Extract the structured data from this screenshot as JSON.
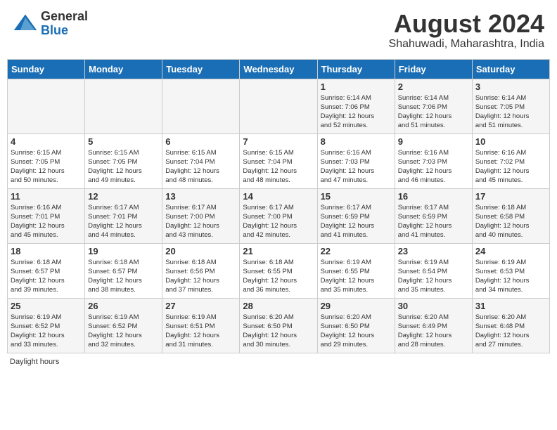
{
  "header": {
    "logo_general": "General",
    "logo_blue": "Blue",
    "month_year": "August 2024",
    "location": "Shahuwadi, Maharashtra, India"
  },
  "days_of_week": [
    "Sunday",
    "Monday",
    "Tuesday",
    "Wednesday",
    "Thursday",
    "Friday",
    "Saturday"
  ],
  "footer": {
    "daylight_label": "Daylight hours"
  },
  "weeks": [
    [
      {
        "num": "",
        "info": ""
      },
      {
        "num": "",
        "info": ""
      },
      {
        "num": "",
        "info": ""
      },
      {
        "num": "",
        "info": ""
      },
      {
        "num": "1",
        "info": "Sunrise: 6:14 AM\nSunset: 7:06 PM\nDaylight: 12 hours\nand 52 minutes."
      },
      {
        "num": "2",
        "info": "Sunrise: 6:14 AM\nSunset: 7:06 PM\nDaylight: 12 hours\nand 51 minutes."
      },
      {
        "num": "3",
        "info": "Sunrise: 6:14 AM\nSunset: 7:05 PM\nDaylight: 12 hours\nand 51 minutes."
      }
    ],
    [
      {
        "num": "4",
        "info": "Sunrise: 6:15 AM\nSunset: 7:05 PM\nDaylight: 12 hours\nand 50 minutes."
      },
      {
        "num": "5",
        "info": "Sunrise: 6:15 AM\nSunset: 7:05 PM\nDaylight: 12 hours\nand 49 minutes."
      },
      {
        "num": "6",
        "info": "Sunrise: 6:15 AM\nSunset: 7:04 PM\nDaylight: 12 hours\nand 48 minutes."
      },
      {
        "num": "7",
        "info": "Sunrise: 6:15 AM\nSunset: 7:04 PM\nDaylight: 12 hours\nand 48 minutes."
      },
      {
        "num": "8",
        "info": "Sunrise: 6:16 AM\nSunset: 7:03 PM\nDaylight: 12 hours\nand 47 minutes."
      },
      {
        "num": "9",
        "info": "Sunrise: 6:16 AM\nSunset: 7:03 PM\nDaylight: 12 hours\nand 46 minutes."
      },
      {
        "num": "10",
        "info": "Sunrise: 6:16 AM\nSunset: 7:02 PM\nDaylight: 12 hours\nand 45 minutes."
      }
    ],
    [
      {
        "num": "11",
        "info": "Sunrise: 6:16 AM\nSunset: 7:01 PM\nDaylight: 12 hours\nand 45 minutes."
      },
      {
        "num": "12",
        "info": "Sunrise: 6:17 AM\nSunset: 7:01 PM\nDaylight: 12 hours\nand 44 minutes."
      },
      {
        "num": "13",
        "info": "Sunrise: 6:17 AM\nSunset: 7:00 PM\nDaylight: 12 hours\nand 43 minutes."
      },
      {
        "num": "14",
        "info": "Sunrise: 6:17 AM\nSunset: 7:00 PM\nDaylight: 12 hours\nand 42 minutes."
      },
      {
        "num": "15",
        "info": "Sunrise: 6:17 AM\nSunset: 6:59 PM\nDaylight: 12 hours\nand 41 minutes."
      },
      {
        "num": "16",
        "info": "Sunrise: 6:17 AM\nSunset: 6:59 PM\nDaylight: 12 hours\nand 41 minutes."
      },
      {
        "num": "17",
        "info": "Sunrise: 6:18 AM\nSunset: 6:58 PM\nDaylight: 12 hours\nand 40 minutes."
      }
    ],
    [
      {
        "num": "18",
        "info": "Sunrise: 6:18 AM\nSunset: 6:57 PM\nDaylight: 12 hours\nand 39 minutes."
      },
      {
        "num": "19",
        "info": "Sunrise: 6:18 AM\nSunset: 6:57 PM\nDaylight: 12 hours\nand 38 minutes."
      },
      {
        "num": "20",
        "info": "Sunrise: 6:18 AM\nSunset: 6:56 PM\nDaylight: 12 hours\nand 37 minutes."
      },
      {
        "num": "21",
        "info": "Sunrise: 6:18 AM\nSunset: 6:55 PM\nDaylight: 12 hours\nand 36 minutes."
      },
      {
        "num": "22",
        "info": "Sunrise: 6:19 AM\nSunset: 6:55 PM\nDaylight: 12 hours\nand 35 minutes."
      },
      {
        "num": "23",
        "info": "Sunrise: 6:19 AM\nSunset: 6:54 PM\nDaylight: 12 hours\nand 35 minutes."
      },
      {
        "num": "24",
        "info": "Sunrise: 6:19 AM\nSunset: 6:53 PM\nDaylight: 12 hours\nand 34 minutes."
      }
    ],
    [
      {
        "num": "25",
        "info": "Sunrise: 6:19 AM\nSunset: 6:52 PM\nDaylight: 12 hours\nand 33 minutes."
      },
      {
        "num": "26",
        "info": "Sunrise: 6:19 AM\nSunset: 6:52 PM\nDaylight: 12 hours\nand 32 minutes."
      },
      {
        "num": "27",
        "info": "Sunrise: 6:19 AM\nSunset: 6:51 PM\nDaylight: 12 hours\nand 31 minutes."
      },
      {
        "num": "28",
        "info": "Sunrise: 6:20 AM\nSunset: 6:50 PM\nDaylight: 12 hours\nand 30 minutes."
      },
      {
        "num": "29",
        "info": "Sunrise: 6:20 AM\nSunset: 6:50 PM\nDaylight: 12 hours\nand 29 minutes."
      },
      {
        "num": "30",
        "info": "Sunrise: 6:20 AM\nSunset: 6:49 PM\nDaylight: 12 hours\nand 28 minutes."
      },
      {
        "num": "31",
        "info": "Sunrise: 6:20 AM\nSunset: 6:48 PM\nDaylight: 12 hours\nand 27 minutes."
      }
    ]
  ]
}
